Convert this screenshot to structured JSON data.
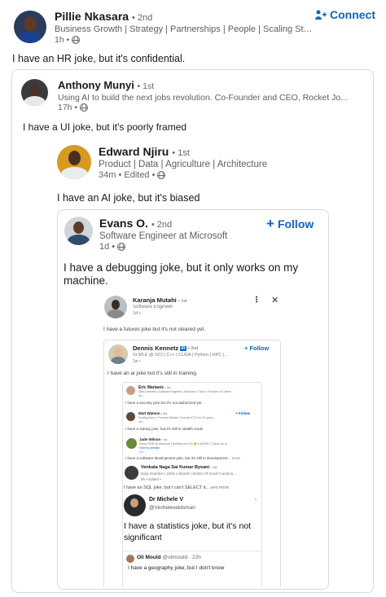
{
  "posts": {
    "pillie": {
      "name": "Pillie Nkasara",
      "degree": "• 2nd",
      "headline": "Business Growth | Strategy | Partnerships | People | Scaling Sta...",
      "time": "1h •",
      "connect_label": "Connect",
      "text": "I have an HR joke, but it's confidential."
    },
    "anthony": {
      "name": "Anthony Munyi",
      "degree": "• 1st",
      "headline": "Using AI to build the next jobs revolution. Co-Founder and CEO, Rocket Jo...",
      "time": "17h •",
      "text": "I have a UI joke, but it's poorly framed"
    },
    "edward": {
      "name": "Edward Njiru",
      "degree": "• 1st",
      "headline": "Product | Data | Agriculture | Architecture",
      "time": "34m • Edited •",
      "text": "I have an AI joke, but it's biased"
    },
    "evans": {
      "name": "Evans O.",
      "degree": "• 2nd",
      "headline": "Software Engineer at Microsoft",
      "time": "1d •",
      "follow_label": "Follow",
      "text": "I have a debugging joke, but it only works on my machine."
    },
    "karanja": {
      "name": "Karanja Mutahi",
      "degree": "• 1st",
      "headline": "Software Engineer",
      "time": "1d •",
      "text": "I have a futures joke but it's not cleared yet."
    },
    "dennis": {
      "name": "Dennis Kennetz",
      "degree": "• 2nd",
      "headline": "Sr MLE @ OCI | C++ | CUDA | Python | HPC |...",
      "time": "1w •",
      "follow_label": "Follow",
      "text": "I have an ai joke but it's still in training."
    },
    "eric": {
      "name": "Eric Mariasis",
      "degree": "• 1st",
      "headline": "Data Scientist | Software Engineer | Educator & Tutor | Founder of Career...",
      "time": "4h •",
      "text": "I have a security joke but it's not authorized yet."
    },
    "matt": {
      "name": "Matt Watson",
      "degree": "• 3rd",
      "headline": "Scaling Devs + Product Minded. Founder/CTO for 20 years....",
      "time": "1d •",
      "follow_label": "+ Follow",
      "text": "I have a startup joke, but it's still in stealth mode"
    },
    "jade": {
      "name": "Jade Wilson",
      "degree": "• 1st",
      "headline": "Senior SRE @ Microsoft | Building live HQ 🙂 | AuDHD | Check out m...",
      "link": "Visit my website",
      "time": "1d •",
      "text": "I have a software development joke, but it's still in development",
      "more": "...more"
    },
    "venkata": {
      "name": "Venkata Naga Sai Kumar Bysani",
      "degree": "• 1st",
      "headline": "Data Scientist | 100K LinkedIn | BCBS Of South Carolina...",
      "time": "9h • Edited •",
      "text": "I have an SQL joke, but I can't SELECT it...",
      "more": "see more"
    },
    "michele": {
      "name": "Dr Michele V",
      "handle": "@micheleveldsman",
      "text": "I have a statistics joke, but it's not significant"
    },
    "oli": {
      "name": "Oli Mould",
      "handle": "@olimould",
      "time": "· 22h",
      "text": "I have a geography joke, but I don't know"
    }
  }
}
